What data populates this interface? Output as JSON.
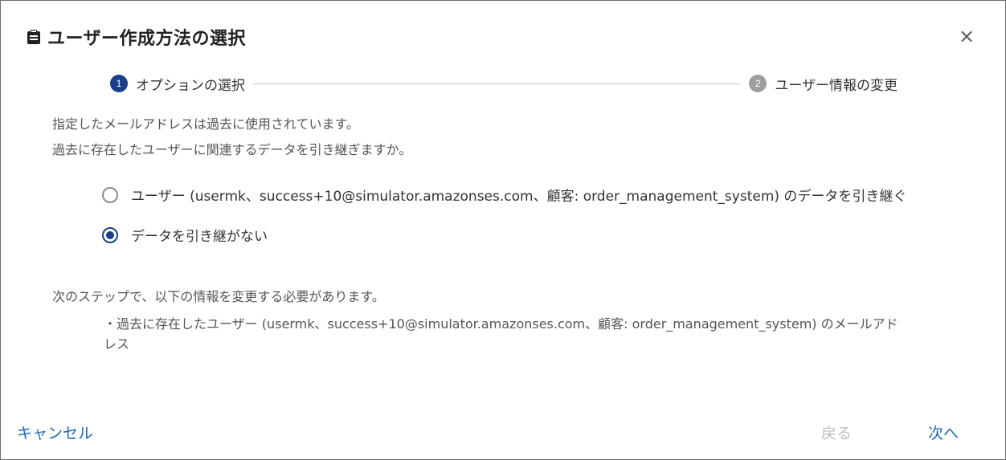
{
  "dialog": {
    "title": "ユーザー作成方法の選択",
    "close_label": "×"
  },
  "stepper": {
    "steps": [
      {
        "number": "1",
        "label": "オプションの選択",
        "state": "active"
      },
      {
        "number": "2",
        "label": "ユーザー情報の変更",
        "state": "inactive"
      }
    ]
  },
  "message": {
    "line1": "指定したメールアドレスは過去に使用されています。",
    "line2": "過去に存在したユーザーに関連するデータを引き継ぎますか。"
  },
  "options": [
    {
      "label": "ユーザー (usermk、success+10@simulator.amazonses.com、顧客: order_management_system) のデータを引き継ぐ",
      "checked": false
    },
    {
      "label": "データを引き継がない",
      "checked": true
    }
  ],
  "next_info": {
    "intro": "次のステップで、以下の情報を変更する必要があります。",
    "bullet": "・過去に存在したユーザー (usermk、success+10@simulator.amazonses.com、顧客: order_management_system) のメールアドレス"
  },
  "footer": {
    "cancel_label": "キャンセル",
    "back_label": "戻る",
    "next_label": "次へ"
  },
  "colors": {
    "accent": "#1a3f87",
    "link": "#1b6ab3",
    "disabled": "#bdbdbd"
  }
}
